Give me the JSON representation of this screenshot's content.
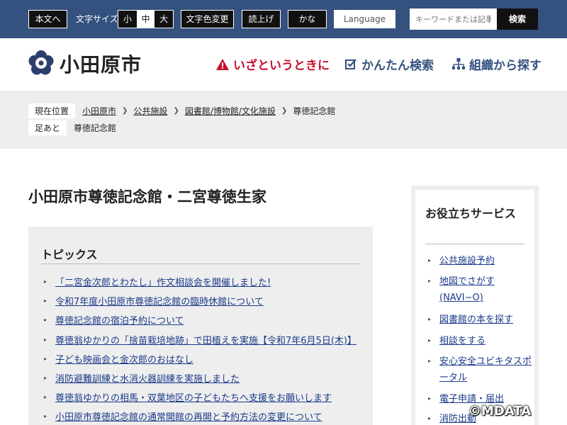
{
  "topbar": {
    "skip_label": "本文へ",
    "font_size_label": "文字サイズ",
    "font_small": "小",
    "font_medium": "中",
    "font_large": "大",
    "color_change": "文字色変更",
    "read_aloud": "読上げ",
    "kana": "かな",
    "language": "Language",
    "search_placeholder": "キーワードまたは記事",
    "search_button": "検索"
  },
  "header": {
    "site_name": "小田原市",
    "emergency": "いざというときに",
    "easy_search": "かんたん検索",
    "org_search": "組織から探す",
    "emergency_color": "#c8102e",
    "nav_color": "#34517f"
  },
  "breadcrumb": {
    "current_label": "現在位置",
    "items": [
      "小田原市",
      "公共施設",
      "図書館/博物館/文化施設",
      "尊徳記念館"
    ],
    "history_label": "足あと",
    "history_items": [
      "尊徳記念館"
    ]
  },
  "main": {
    "title": "小田原市尊徳記念館・二宮尊徳生家",
    "topics_title": "トピックス",
    "topics": [
      "「二宮金次郎とわたし」作文相談会を開催しました!",
      "令和7年度小田原市尊徳記念館の臨時休館について",
      "尊徳記念館の宿泊予約について",
      "尊徳翁ゆかりの「捨苗栽培地跡」で田植えを実施【令和7年6月5日(木)】",
      "子ども映画会と金次郎のおはなし",
      "消防避難訓練と水消火器訓練を実施しました",
      "尊徳翁ゆかりの相馬・双葉地区の子どもたちへ支援をお願いします",
      "小田原市尊徳記念館の通常開館の再開と予約方法の変更について"
    ]
  },
  "sidebar": {
    "title": "お役立ちサービス",
    "items": [
      "公共施設予約",
      "地図でさがす(NAVI−O)",
      "図書館の本を探す",
      "相談をする",
      "安心安全ユビキタスポータル",
      "電子申請・届出",
      "消防出動"
    ]
  },
  "watermark": "©MDATA"
}
